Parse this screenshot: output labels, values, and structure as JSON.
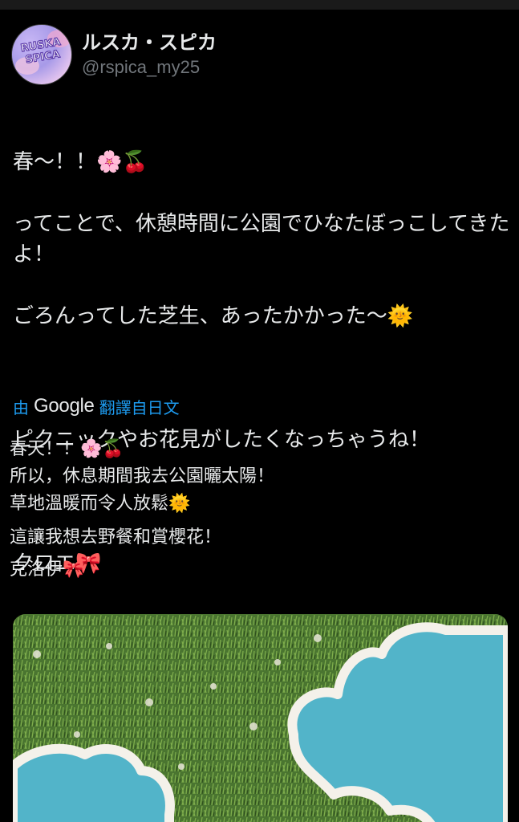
{
  "user": {
    "avatar_text": "RUSKA SPICA",
    "display_name": "ルスカ・スピカ",
    "handle": "@rspica_my25"
  },
  "tweet": {
    "lines": [
      "春～！！🌸🍒",
      "ってことで、休憩時間に公園でひなたぼっこしてきたよ！",
      "ごろんってした芝生、あったかかった～🌞",
      "",
      "ピクニックやお花見がしたくなっちゃうね！",
      "",
      "クロエ🎀"
    ]
  },
  "translation": {
    "prefix": "由",
    "provider": "Google",
    "label": "翻譯自日文",
    "lines": [
      "春天！！🌸🍒",
      "所以，休息期間我去公園曬太陽！",
      "草地溫暖而令人放鬆🌞",
      "這讓我想去野餐和賞櫻花！",
      "克洛伊🎀"
    ]
  },
  "media": {
    "kind": "photo"
  },
  "colors": {
    "background": "#000000",
    "text": "#e7e9ea",
    "secondary": "#71767b",
    "link": "#1d9bf0",
    "grass": "#4d7a33",
    "chalk_blue": "#4fb3c8"
  }
}
